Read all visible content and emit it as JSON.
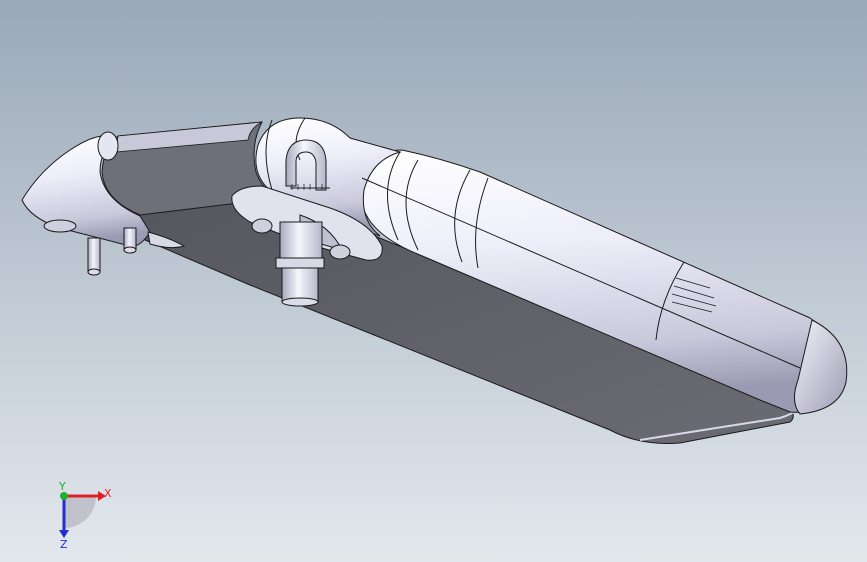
{
  "viewport": {
    "background_top": "#9aa8b8",
    "background_bottom": "#e3e8ed",
    "model_body_color": "#e9e9f6",
    "model_shadow_color": "#5c5d66",
    "outline_color": "#1a1a1a"
  },
  "triad": {
    "x_label": "X",
    "y_label": "Y",
    "z_label": "Z",
    "x_color": "#e02020",
    "y_color": "#20b030",
    "z_color": "#2030d0"
  }
}
